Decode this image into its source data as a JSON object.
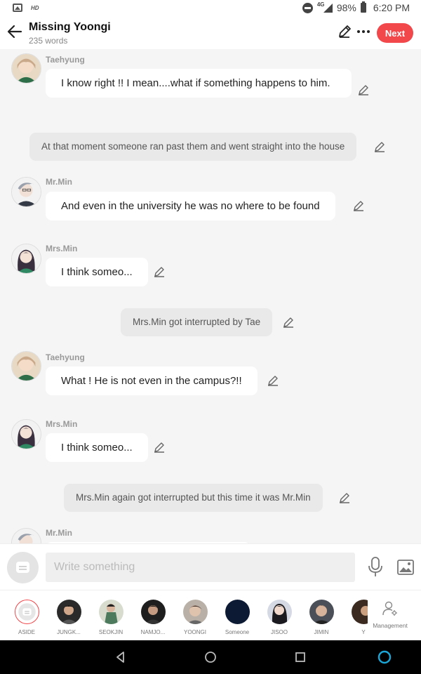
{
  "status_bar": {
    "hd_label": "HD",
    "network_label": "4G",
    "battery": "98%",
    "time": "6:20 PM"
  },
  "header": {
    "title": "Missing Yoongi",
    "word_count": "235 words",
    "next_label": "Next",
    "accent_color": "#f2474b"
  },
  "messages": [
    {
      "type": "dialogue",
      "speaker": "Taehyung",
      "text": "I know right !! I mean....what if something happens to him."
    },
    {
      "type": "narration",
      "text": "At that moment someone ran past them and went straight into the house"
    },
    {
      "type": "dialogue",
      "speaker": "Mr.Min",
      "text": "And even in the university he was no where to be found"
    },
    {
      "type": "dialogue",
      "speaker": "Mrs.Min",
      "text": "I think someo..."
    },
    {
      "type": "narration",
      "text": "Mrs.Min got interrupted by Tae"
    },
    {
      "type": "dialogue",
      "speaker": "Taehyung",
      "text": "What ! He is not even in the campus?!!"
    },
    {
      "type": "dialogue",
      "speaker": "Mrs.Min",
      "text": "I think someo..."
    },
    {
      "type": "narration",
      "text": "Mrs.Min again got interrupted but this time it was Mr.Min"
    },
    {
      "type": "dialogue",
      "speaker": "Mr.Min",
      "text": ""
    }
  ],
  "input": {
    "placeholder": "Write something",
    "value": ""
  },
  "characters": [
    {
      "label": "ASIDE"
    },
    {
      "label": "JUNGK..."
    },
    {
      "label": "SEOKJIN"
    },
    {
      "label": "NAMJO..."
    },
    {
      "label": "YOONGI"
    },
    {
      "label": "Someone"
    },
    {
      "label": "JISOO"
    },
    {
      "label": "JIMIN"
    },
    {
      "label": "Y"
    }
  ],
  "management_label": "Management"
}
